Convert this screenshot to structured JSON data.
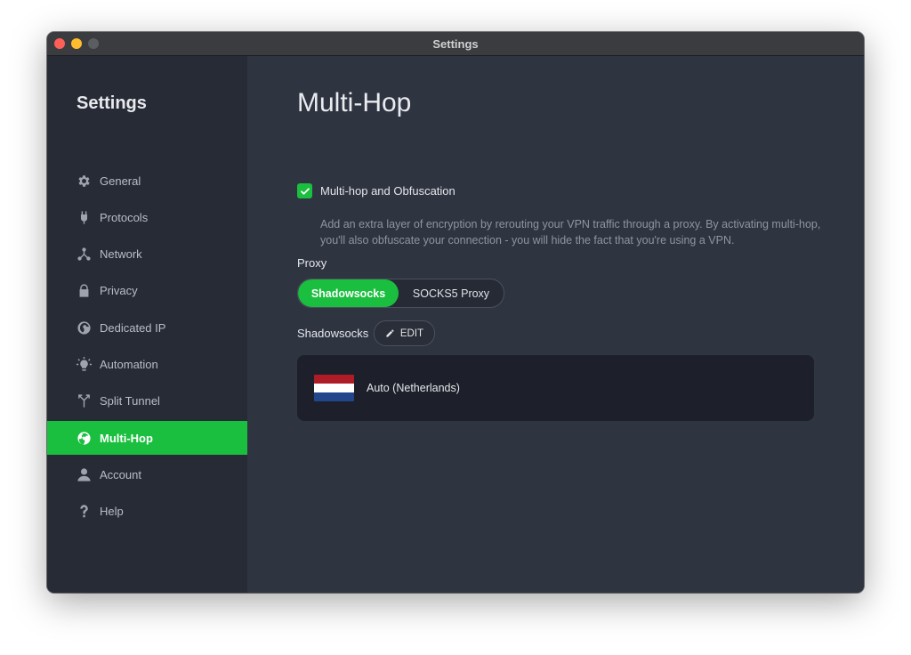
{
  "window": {
    "title": "Settings"
  },
  "sidebar": {
    "title": "Settings",
    "items": [
      {
        "label": "General",
        "icon": "gear-icon"
      },
      {
        "label": "Protocols",
        "icon": "protocols-icon"
      },
      {
        "label": "Network",
        "icon": "network-icon"
      },
      {
        "label": "Privacy",
        "icon": "lock-icon"
      },
      {
        "label": "Dedicated IP",
        "icon": "dedicated-ip-icon"
      },
      {
        "label": "Automation",
        "icon": "automation-icon"
      },
      {
        "label": "Split Tunnel",
        "icon": "split-tunnel-icon"
      },
      {
        "label": "Multi-Hop",
        "icon": "globe-icon",
        "active": true
      },
      {
        "label": "Account",
        "icon": "person-icon"
      },
      {
        "label": "Help",
        "icon": "question-icon"
      }
    ]
  },
  "main": {
    "title": "Multi-Hop",
    "multihop": {
      "checked": true,
      "label": "Multi-hop and Obfuscation",
      "description": "Add an extra layer of encryption by rerouting your VPN traffic through a proxy. By activating multi-hop, you'll also obfuscate your connection - you will hide the fact that you're using a VPN."
    },
    "proxy": {
      "label": "Proxy",
      "options": [
        "Shadowsocks",
        "SOCKS5 Proxy"
      ],
      "selected": "Shadowsocks"
    },
    "shadowsocks": {
      "label": "Shadowsocks",
      "edit_label": "EDIT",
      "server": "Auto (Netherlands)",
      "flag_colors": [
        "#ae1c28",
        "#ffffff",
        "#21468b"
      ]
    }
  },
  "colors": {
    "accent": "#1bbf3f"
  }
}
